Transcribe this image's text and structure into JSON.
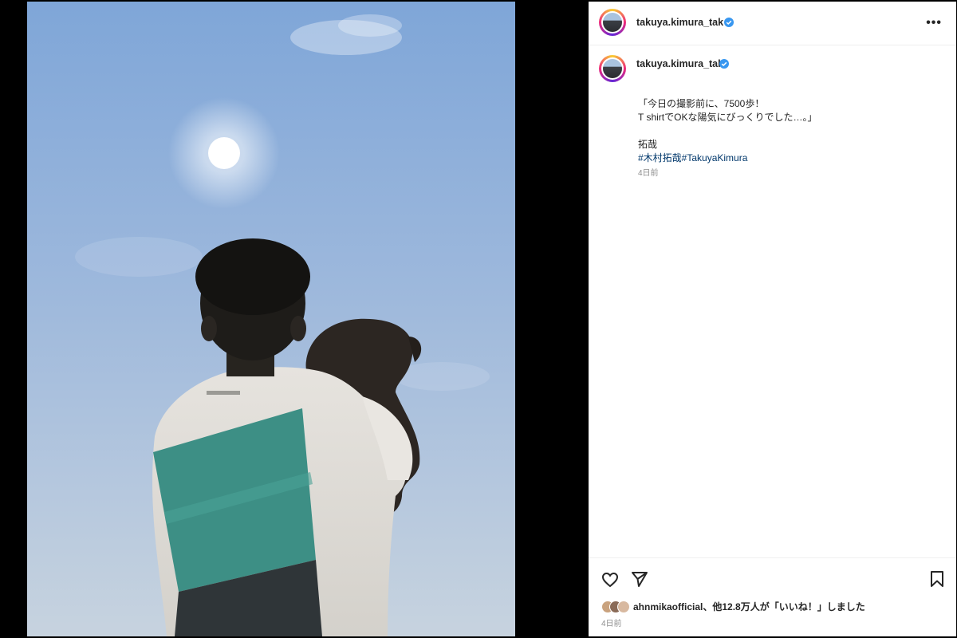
{
  "post": {
    "username": "takuya.kimura_tak",
    "caption_lines": [
      "「今日の撮影前に、7500歩！",
      "T shirtでOKな陽気にびっくりでした…。」"
    ],
    "signature": "拓哉",
    "hashtags": "#木村拓哉#TakuyaKimura",
    "caption_time": "4日前",
    "likes_user": "ahnmikaofficial",
    "likes_text": "、他12.8万人が「いいね！」しました",
    "post_time": "4日前"
  },
  "icons": [
    "verified-badge-icon",
    "more-options-icon",
    "heart-icon",
    "share-icon",
    "bookmark-icon"
  ],
  "colors": {
    "verified": "#3897f0",
    "hashtag": "#00376b",
    "muted": "#8e8e8e"
  }
}
